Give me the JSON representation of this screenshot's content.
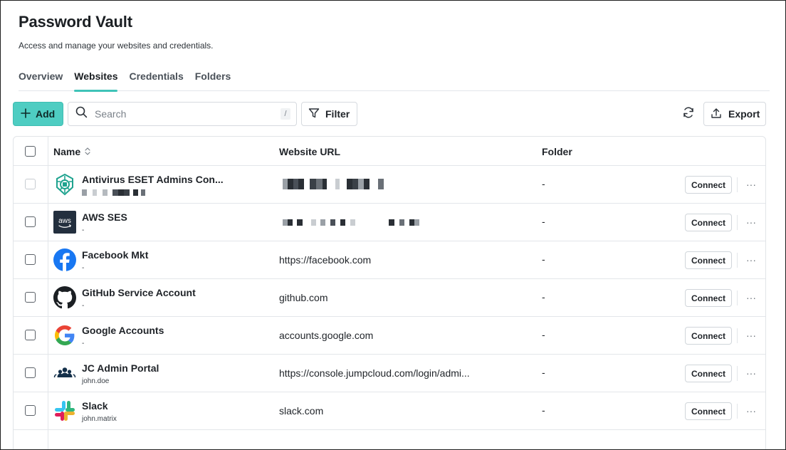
{
  "header": {
    "title": "Password Vault",
    "subtitle": "Access and manage your websites and credentials."
  },
  "tabs": [
    {
      "label": "Overview",
      "active": false
    },
    {
      "label": "Websites",
      "active": true
    },
    {
      "label": "Credentials",
      "active": false
    },
    {
      "label": "Folders",
      "active": false
    }
  ],
  "toolbar": {
    "add_label": "Add",
    "search_placeholder": "Search",
    "search_shortcut": "/",
    "filter_label": "Filter",
    "export_label": "Export"
  },
  "table": {
    "columns": {
      "name": "Name",
      "url": "Website URL",
      "folder": "Folder"
    },
    "connect_label": "Connect",
    "more_label": "···",
    "rows": [
      {
        "name": "Antivirus ESET Admins Con...",
        "username": "",
        "url": "",
        "folder": "-",
        "icon": "eset-logo-icon",
        "redacted_url": true,
        "redacted_user": true
      },
      {
        "name": "AWS SES",
        "username": "-",
        "url": "",
        "folder": "-",
        "icon": "aws-logo-icon",
        "redacted_url": true
      },
      {
        "name": "Facebook Mkt",
        "username": "-",
        "url": "https://facebook.com",
        "folder": "-",
        "icon": "facebook-logo-icon"
      },
      {
        "name": "GitHub Service Account",
        "username": "-",
        "url": "github.com",
        "folder": "-",
        "icon": "github-logo-icon"
      },
      {
        "name": "Google Accounts",
        "username": "-",
        "url": "accounts.google.com",
        "folder": "-",
        "icon": "google-logo-icon"
      },
      {
        "name": "JC Admin Portal",
        "username": "john.doe",
        "url": "https://console.jumpcloud.com/login/admi...",
        "folder": "-",
        "icon": "jumpcloud-logo-icon"
      },
      {
        "name": "Slack",
        "username": "john.matrix",
        "url": "slack.com",
        "folder": "-",
        "icon": "slack-logo-icon"
      }
    ]
  },
  "colors": {
    "accent": "#4ecdc2",
    "tab_underline": "#3fc3b8",
    "text": "#1f2328",
    "border": "#e3e6ea"
  }
}
